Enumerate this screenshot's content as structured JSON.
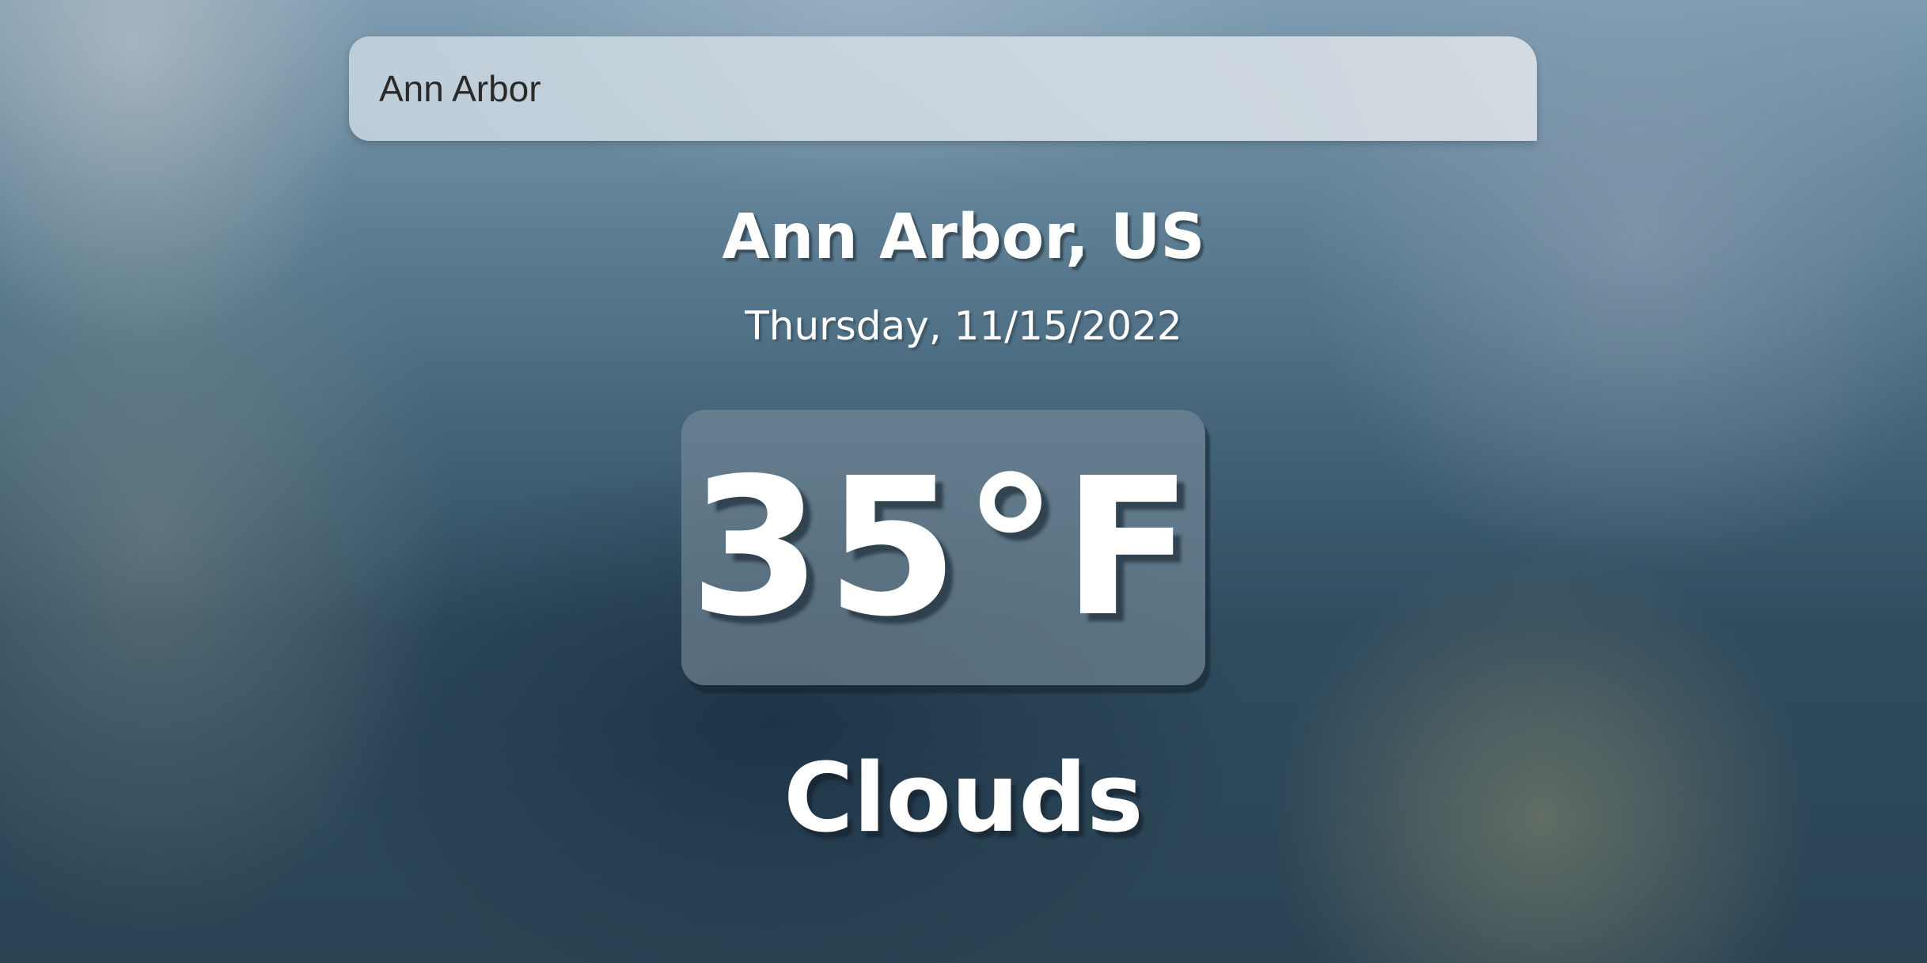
{
  "search": {
    "value": "Ann Arbor"
  },
  "weather": {
    "location": "Ann Arbor, US",
    "date": "Thursday, 11/15/2022",
    "temperature": "35°F",
    "condition": "Clouds"
  },
  "colors": {
    "text": "#ffffff",
    "search_text": "#2a2a2a",
    "search_background": "#d3dde5"
  }
}
